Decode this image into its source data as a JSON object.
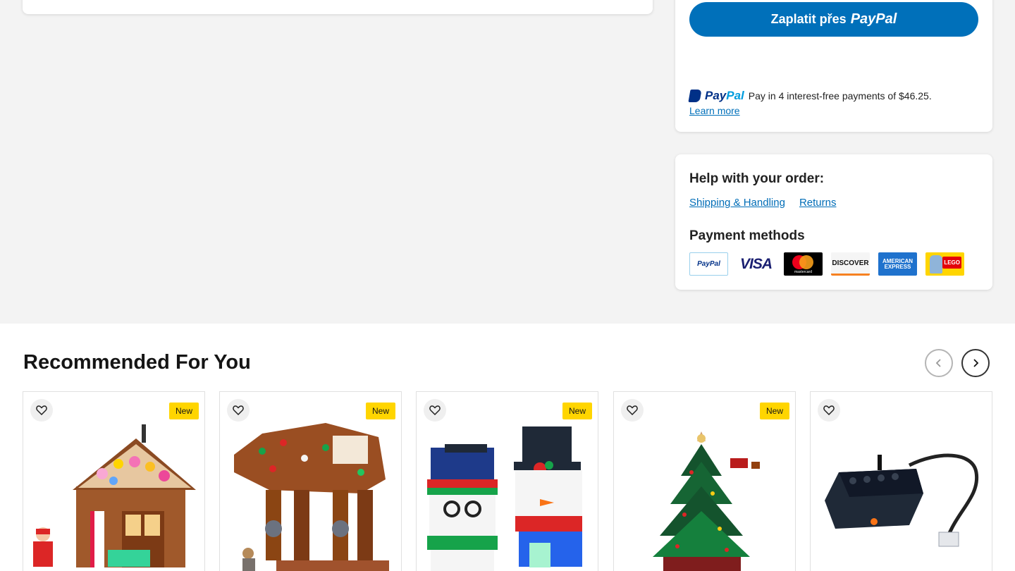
{
  "payment": {
    "paypal_button_prefix": "Zaplatit přes",
    "paypal_button_brand": "PayPal",
    "paylater_brand": "PayPal",
    "paylater_text": "Pay in 4 interest-free payments of $46.25.",
    "learn_more": "Learn more"
  },
  "help": {
    "title": "Help with your order:",
    "links": [
      "Shipping & Handling",
      "Returns"
    ],
    "payment_methods_title": "Payment methods",
    "methods": [
      {
        "name": "PayPal",
        "label": "PayPal"
      },
      {
        "name": "Visa",
        "label": "VISA"
      },
      {
        "name": "Mastercard",
        "label": "mastercard"
      },
      {
        "name": "Discover",
        "label": "DISCOVER"
      },
      {
        "name": "American Express",
        "label": "AMERICAN EXPRESS"
      },
      {
        "name": "LEGO",
        "label": "LEGO"
      }
    ]
  },
  "recommended": {
    "title": "Recommended For You",
    "products": [
      {
        "image": "gingerbread-house",
        "badge": "New"
      },
      {
        "image": "gingerbread-at-at",
        "badge": "New"
      },
      {
        "image": "snowmen-brickheadz",
        "badge": "New"
      },
      {
        "image": "christmas-tree",
        "badge": "New"
      },
      {
        "image": "train-motor",
        "badge": ""
      }
    ]
  },
  "colors": {
    "paypal_blue": "#0070ba",
    "badge_yellow": "#ffd500",
    "link_blue": "#006db7"
  }
}
